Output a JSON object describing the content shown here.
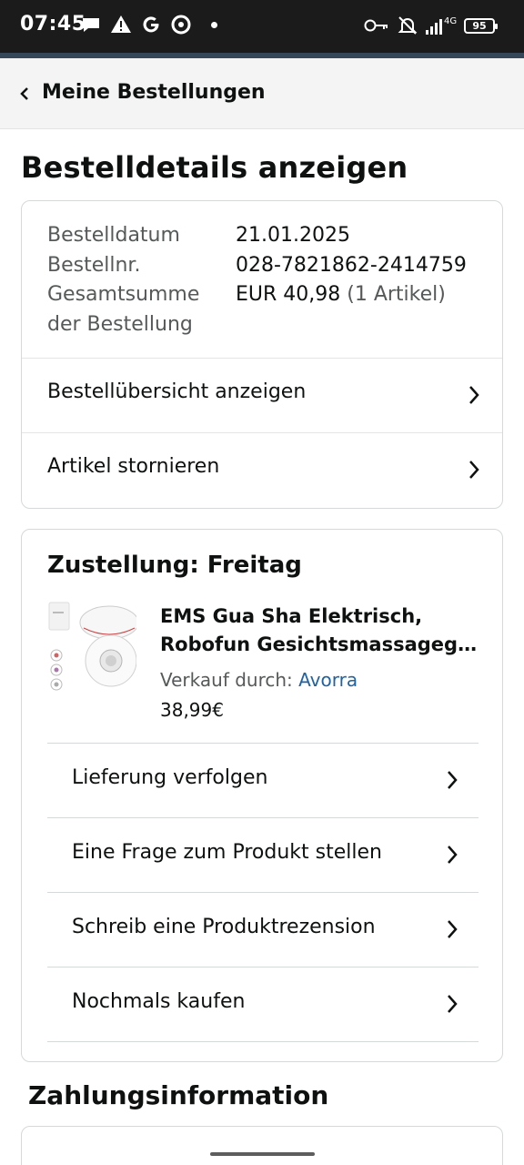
{
  "status_bar": {
    "time": "07:45",
    "left_icons": [
      "chat-bubble-icon",
      "warning-icon",
      "google-icon",
      "cast-icon",
      "dot-icon"
    ],
    "right_icons": [
      "key-icon",
      "bell-off-icon",
      "signal-icon",
      "network-4g-icon"
    ],
    "network": "4G",
    "battery": "95"
  },
  "header": {
    "back_label": "Meine Bestellungen"
  },
  "page_title": "Bestelldetails anzeigen",
  "order_info": {
    "date_label": "Bestelldatum",
    "date_value": "21.01.2025",
    "number_label": "Bestellnr.",
    "number_value": "028-7821862-2414759",
    "total_label_1": "Gesamtsumme",
    "total_label_2": "der Bestellung",
    "total_value": "EUR 40,98",
    "total_items": "(1 Artikel)"
  },
  "order_actions": [
    {
      "label": "Bestellübersicht anzeigen"
    },
    {
      "label": "Artikel stornieren"
    }
  ],
  "delivery": {
    "heading": "Zustellung: Freitag",
    "product": {
      "title_line1": "EMS Gua Sha Elektrisch,",
      "title_line2": "Robofun Gesichtsmassagege...",
      "seller_prefix": "Verkauf durch: ",
      "seller_name": "Avorra",
      "price": "38,99€"
    },
    "actions": [
      {
        "label": "Lieferung verfolgen"
      },
      {
        "label": "Eine Frage zum Produkt stellen"
      },
      {
        "label": "Schreib eine Produktrezension"
      },
      {
        "label": "Nochmals kaufen"
      }
    ]
  },
  "payment_section_title": "Zahlungsinformation"
}
